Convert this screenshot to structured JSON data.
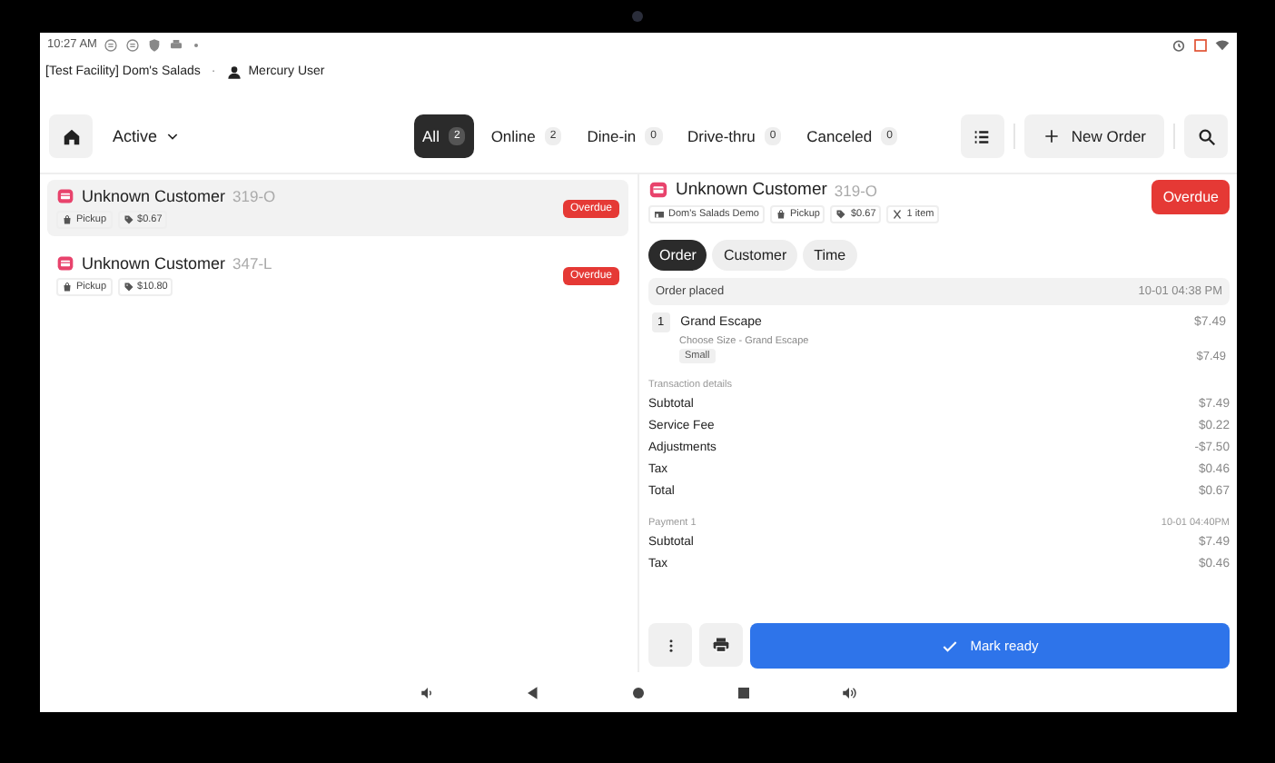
{
  "status_bar": {
    "time": "10:27 AM"
  },
  "header": {
    "facility": "[Test Facility] Dom's Salads",
    "separator": "·",
    "user": "Mercury User"
  },
  "toolbar": {
    "status_filter": "Active",
    "tabs": [
      {
        "label": "All",
        "count": "2",
        "selected": true
      },
      {
        "label": "Online",
        "count": "2",
        "selected": false
      },
      {
        "label": "Dine-in",
        "count": "0",
        "selected": false
      },
      {
        "label": "Drive-thru",
        "count": "0",
        "selected": false
      },
      {
        "label": "Canceled",
        "count": "0",
        "selected": false
      }
    ],
    "new_order": "New Order"
  },
  "orders": [
    {
      "customer": "Unknown Customer",
      "code": "319-O",
      "type": "Pickup",
      "amount": "$0.67",
      "badge": "Overdue",
      "selected": true
    },
    {
      "customer": "Unknown Customer",
      "code": "347-L",
      "type": "Pickup",
      "amount": "$10.80",
      "badge": "Overdue",
      "selected": false
    }
  ],
  "detail": {
    "customer": "Unknown Customer",
    "code": "319-O",
    "badge": "Overdue",
    "meta": [
      "Dom's Salads Demo",
      "Pickup",
      "$0.67",
      "1 item"
    ],
    "tabs": [
      {
        "label": "Order",
        "selected": true
      },
      {
        "label": "Customer",
        "selected": false
      },
      {
        "label": "Time",
        "selected": false
      }
    ],
    "placed": {
      "label": "Order placed",
      "time": "10-01 04:38 PM"
    },
    "items": [
      {
        "qty": "1",
        "name": "Grand Escape",
        "price": "$7.49",
        "modifier_group": "Choose Size - Grand Escape",
        "modifier": "Small",
        "modifier_price": "$7.49"
      }
    ],
    "transaction": {
      "title": "Transaction details",
      "rows": [
        {
          "label": "Subtotal",
          "value": "$7.49"
        },
        {
          "label": "Service Fee",
          "value": "$0.22"
        },
        {
          "label": "Adjustments",
          "value": "-$7.50"
        },
        {
          "label": "Tax",
          "value": "$0.46"
        },
        {
          "label": "Total",
          "value": "$0.67"
        }
      ]
    },
    "payment": {
      "title": "Payment 1",
      "time": "10-01 04:40PM",
      "rows": [
        {
          "label": "Subtotal",
          "value": "$7.49"
        },
        {
          "label": "Tax",
          "value": "$0.46"
        }
      ]
    },
    "primary_action": "Mark ready"
  }
}
